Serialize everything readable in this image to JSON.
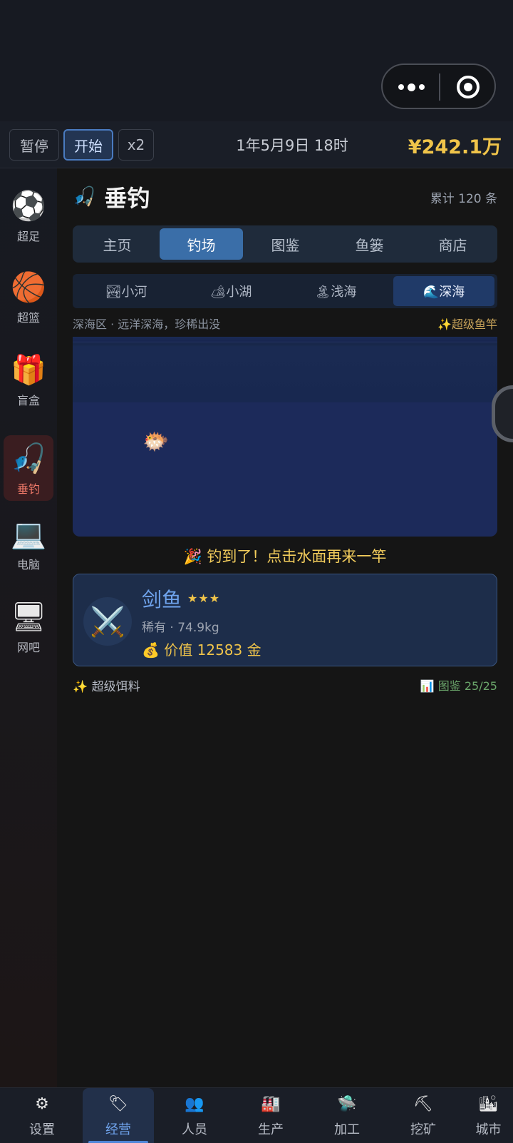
{
  "capsule": {
    "more_icon": "more-dots-icon",
    "close_icon": "target-circle-icon"
  },
  "controls": {
    "pause": "暂停",
    "start": "开始",
    "speed": "x2",
    "datetime": "1年5月9日 18时",
    "money": "¥242.1万"
  },
  "sidebar": {
    "items": [
      {
        "label": "超足",
        "icon": "soccer-badge-icon",
        "glyph": "⚽"
      },
      {
        "label": "超篮",
        "icon": "basketball-icon",
        "glyph": "🏀"
      },
      {
        "label": "盲盒",
        "icon": "gift-box-icon",
        "glyph": "🎁"
      },
      {
        "label": "垂钓",
        "icon": "fishing-icon",
        "glyph": "🎣"
      },
      {
        "label": "电脑",
        "icon": "computer-icon",
        "glyph": "💻"
      },
      {
        "label": "网吧",
        "icon": "internet-cafe-icon",
        "glyph": "🖥"
      }
    ]
  },
  "main": {
    "title": "垂钓",
    "total": "累计 120 条",
    "tabs": [
      {
        "label": "主页"
      },
      {
        "label": "钓场"
      },
      {
        "label": "图鉴"
      },
      {
        "label": "鱼篓"
      },
      {
        "label": "商店"
      }
    ],
    "subtabs": [
      {
        "label": "🏞小河"
      },
      {
        "label": "🏕小湖"
      },
      {
        "label": "🏝浅海"
      },
      {
        "label": "🌊深海"
      }
    ],
    "area_desc": "深海区 · 远洋深海，珍稀出没",
    "rod": "✨超级鱼竿",
    "catch_msg": "🎉 钓到了！点击水面再来一竿",
    "catch": {
      "name": "剑鱼",
      "stars": "★★★",
      "rarity": "稀有 · 74.9kg",
      "value": "💰 价值 12583 金"
    },
    "bait": "✨ 超级饵料",
    "dex": "📊 图鉴 25/25"
  },
  "bottom_nav": {
    "items": [
      {
        "label": "设置",
        "icon": "gear-icon",
        "glyph": "⚙"
      },
      {
        "label": "经营",
        "icon": "manage-icon",
        "glyph": "🏷"
      },
      {
        "label": "人员",
        "icon": "people-icon",
        "glyph": "👥"
      },
      {
        "label": "生产",
        "icon": "factory-icon",
        "glyph": "🏭"
      },
      {
        "label": "加工",
        "icon": "process-icon",
        "glyph": "🛸"
      },
      {
        "label": "挖矿",
        "icon": "mining-icon",
        "glyph": "⛏"
      },
      {
        "label": "城市",
        "icon": "city-icon",
        "glyph": "🏙"
      }
    ]
  },
  "colors": {
    "accent": "#3a6ea8",
    "gold": "#f0c44a",
    "sidebar_active": "#3a1d20",
    "water": "#1c2a5a"
  }
}
